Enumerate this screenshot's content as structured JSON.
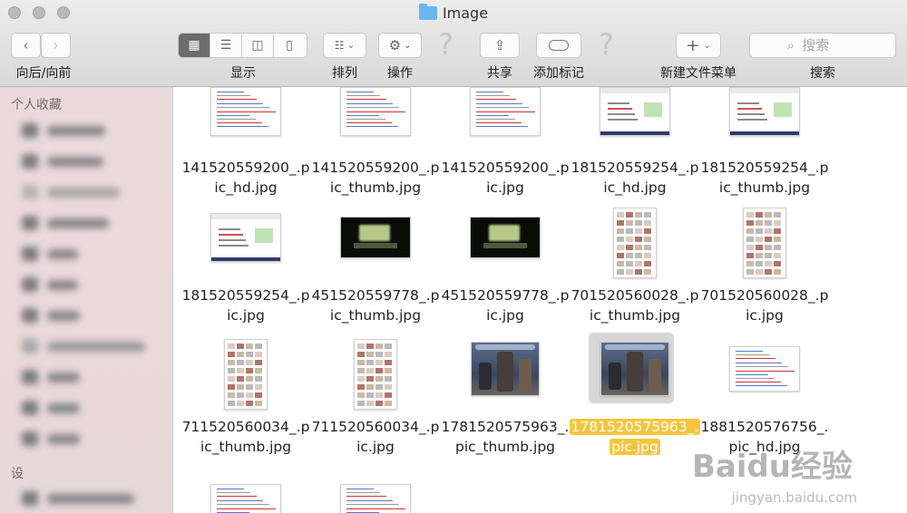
{
  "window": {
    "title": "Image"
  },
  "toolbar": {
    "back_forward_label": "向后/向前",
    "view_label": "显示",
    "arrange_label": "排列",
    "action_label": "操作",
    "share_label": "共享",
    "tags_label": "添加标记",
    "new_folder_menu_label": "新建文件菜单",
    "search_label": "搜索",
    "search_placeholder": "搜索",
    "active_view": "icon"
  },
  "sidebar": {
    "section_favorites": "个人收藏",
    "section_devices": "设"
  },
  "files": [
    {
      "line1": "141520559200_.p",
      "line2": "ic_hd.jpg",
      "kind": "doc"
    },
    {
      "line1": "141520559200_.p",
      "line2": "ic_thumb.jpg",
      "kind": "doc"
    },
    {
      "line1": "141520559200_.p",
      "line2": "ic.jpg",
      "kind": "doc"
    },
    {
      "line1": "181520559254_.p",
      "line2": "ic_hd.jpg",
      "kind": "screen"
    },
    {
      "line1": "181520559254_.p",
      "line2": "ic_thumb.jpg",
      "kind": "screen"
    },
    {
      "line1": "181520559254_.p",
      "line2": "ic.jpg",
      "kind": "screen"
    },
    {
      "line1": "451520559778_.p",
      "line2": "ic_thumb.jpg",
      "kind": "laptop"
    },
    {
      "line1": "451520559778_.p",
      "line2": "ic.jpg",
      "kind": "laptop"
    },
    {
      "line1": "701520560028_.p",
      "line2": "ic_thumb.jpg",
      "kind": "menu"
    },
    {
      "line1": "701520560028_.p",
      "line2": "ic.jpg",
      "kind": "menu"
    },
    {
      "line1": "711520560034_.p",
      "line2": "ic_thumb.jpg",
      "kind": "menu"
    },
    {
      "line1": "711520560034_.p",
      "line2": "ic.jpg",
      "kind": "menu"
    },
    {
      "line1": "17815205759​63_.",
      "line2": "pic_thumb.jpg",
      "kind": "photo"
    },
    {
      "line1": "1781520575963_.",
      "line2": "pic.jpg",
      "kind": "photo",
      "selected": true
    },
    {
      "line1": "1881520576756_.",
      "line2": "pic_hd.jpg",
      "kind": "doc2"
    }
  ],
  "watermark": {
    "text": "Baidu经验",
    "url": "jingyan.baidu.com"
  },
  "colors": {
    "selection": "#f5c53d",
    "sidebar": "#ebd9db"
  }
}
